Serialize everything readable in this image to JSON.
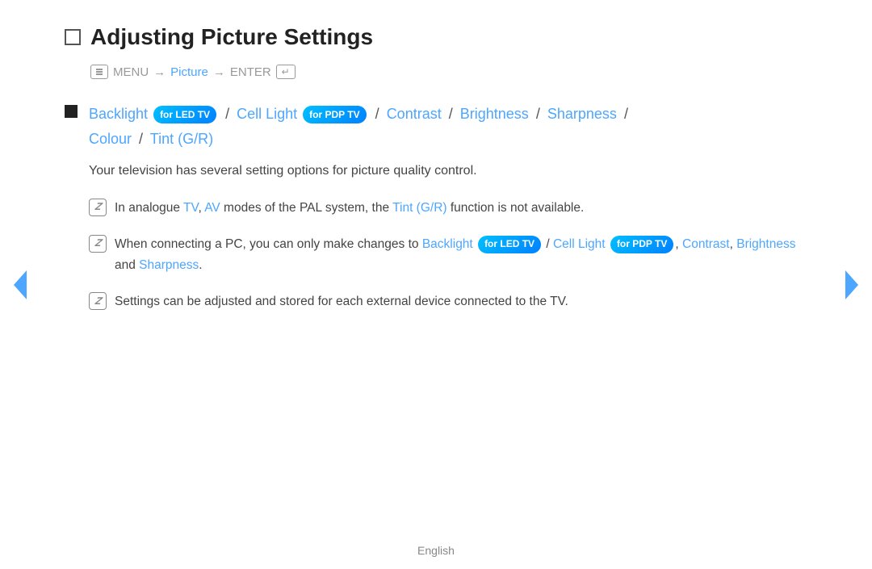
{
  "page": {
    "title": "Adjusting Picture Settings",
    "menu_path": {
      "menu_label": "MENU",
      "arrow1": "→",
      "picture": "Picture",
      "arrow2": "→",
      "enter": "ENTER"
    },
    "heading": {
      "backlight": "Backlight",
      "badge_led": "for LED TV",
      "slash1": "/",
      "cell_light": "Cell Light",
      "badge_pdp": "for PDP TV",
      "slash2": "/",
      "contrast": "Contrast",
      "slash3": "/",
      "brightness": "Brightness",
      "slash4": "/",
      "sharpness": "Sharpness",
      "slash5": "/",
      "colour": "Colour",
      "slash6": "/",
      "tint": "Tint (G/R)"
    },
    "description": "Your television has several setting options for picture quality control.",
    "notes": [
      {
        "id": "note1",
        "text_before": "In analogue ",
        "tv": "TV",
        "comma1": ", ",
        "av": "AV",
        "text_middle": " modes of the PAL system, the ",
        "tint": "Tint (G/R)",
        "text_after": " function is not available."
      },
      {
        "id": "note2",
        "text_before": "When connecting a PC, you can only make changes to ",
        "backlight": "Backlight",
        "badge_led": "for LED TV",
        "slash": " / ",
        "cell_light": "Cell Light",
        "badge_pdp": "for PDP TV",
        "comma": ", ",
        "contrast": "Contrast",
        "comma2": ", ",
        "brightness": "Brightness",
        "and": " and ",
        "sharpness": "Sharpness",
        "period": "."
      },
      {
        "id": "note3",
        "text": "Settings can be adjusted and stored for each external device connected to the TV."
      }
    ],
    "footer": "English"
  }
}
